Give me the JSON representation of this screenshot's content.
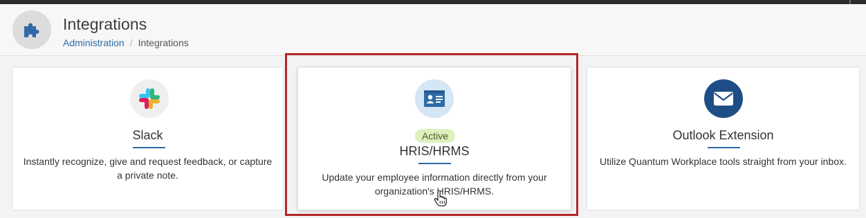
{
  "header": {
    "icon": "puzzle-piece-icon",
    "title": "Integrations",
    "breadcrumb": [
      {
        "label": "Administration",
        "link": true
      },
      {
        "label": "Integrations",
        "link": false
      }
    ],
    "breadcrumb_separator": "/"
  },
  "integrations": [
    {
      "name": "Slack",
      "icon": "slack-logo-icon",
      "description_lines": [
        "Instantly recognize, give and request feedback, or capture",
        "a private note."
      ]
    },
    {
      "name": "HRIS/HRMS",
      "icon": "id-card-icon",
      "status": "Active",
      "description_lines": [
        "Update your employee information directly from your",
        "organization's HRIS/HRMS."
      ]
    },
    {
      "name": "Outlook Extension",
      "icon": "envelope-icon",
      "description_lines": [
        "Utilize Quantum Workplace tools straight from your inbox."
      ]
    }
  ],
  "colors": {
    "link": "#2f6aa6",
    "highlight_border": "#b3262a",
    "active_badge_bg": "#dff0bd",
    "outlook_icon_bg": "#1f4e86",
    "hris_icon_bg": "#d5e6f5"
  }
}
